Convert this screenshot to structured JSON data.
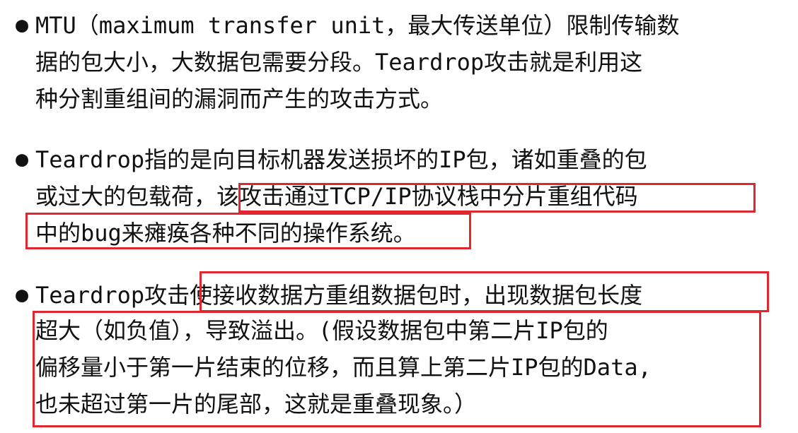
{
  "bullet_glyph": "●",
  "accent_color": "#e0262f",
  "paragraphs": [
    {
      "lines": [
        "MTU（maximum transfer unit，最大传送单位）限制传输数",
        "据的包大小，大数据包需要分段。Teardrop攻击就是利用这",
        "种分割重组间的漏洞而产生的攻击方式。"
      ]
    },
    {
      "lines": [
        "Teardrop指的是向目标机器发送损坏的IP包，诸如重叠的包",
        "或过大的包载荷，该攻击通过TCP/IP协议栈中分片重组代码",
        "中的bug来瘫痪各种不同的操作系统。"
      ],
      "highlight": "该攻击通过TCP/IP协议栈中分片重组代码中的bug来瘫痪各种不同的操作系统。"
    },
    {
      "lines": [
        "Teardrop攻击使接收数据方重组数据包时，出现数据包长度",
        "超大（如负值），导致溢出。(假设数据包中第二片IP包的",
        "偏移量小于第一片结束的位移，而且算上第二片IP包的Data,",
        "也未超过第一片的尾部，这就是重叠现象。）"
      ],
      "highlight": "使接收数据方重组数据包时，出现数据包长度超大（如负值），导致溢出。(假设数据包中第二片IP包的偏移量小于第一片结束的位移，而且算上第二片IP包的Data,也未超过第一片的尾部，这就是重叠现象。）"
    }
  ]
}
